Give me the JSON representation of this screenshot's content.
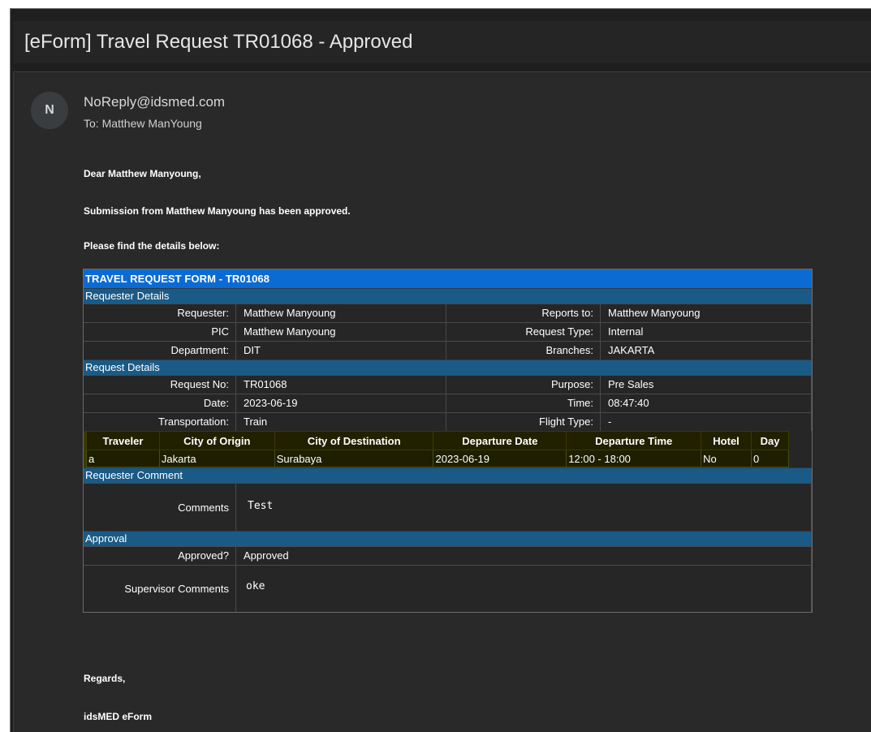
{
  "subject": "[eForm] Travel Request TR01068 - Approved",
  "sender": {
    "initial": "N",
    "from": "NoReply@idsmed.com",
    "to": "To:  Matthew ManYoung"
  },
  "body": {
    "greeting": "Dear Matthew Manyoung,",
    "line1": "Submission from Matthew Manyoung has been approved.",
    "line2": "Please find the details below:",
    "regards": "Regards,",
    "signature": "idsMED eForm"
  },
  "form": {
    "title": "TRAVEL REQUEST FORM - TR01068",
    "requester_section": "Requester Details",
    "requester_rows": [
      {
        "l1": "Requester:",
        "v1": "Matthew Manyoung",
        "l2": "Reports to:",
        "v2": "Matthew Manyoung"
      },
      {
        "l1": "PIC",
        "v1": "Matthew Manyoung",
        "l2": "Request Type:",
        "v2": "Internal"
      },
      {
        "l1": "Department:",
        "v1": "DIT",
        "l2": "Branches:",
        "v2": "JAKARTA"
      }
    ],
    "request_section": "Request Details",
    "request_rows": [
      {
        "l1": "Request No:",
        "v1": "TR01068",
        "l2": "Purpose:",
        "v2": "Pre Sales"
      },
      {
        "l1": "Date:",
        "v1": "2023-06-19",
        "l2": "Time:",
        "v2": "08:47:40"
      },
      {
        "l1": "Transportation:",
        "v1": "Train",
        "l2": "Flight Type:",
        "v2": "-"
      }
    ],
    "travel_headers": [
      "Traveler",
      "City of Origin",
      "City of Destination",
      "Departure Date",
      "Departure Time",
      "Hotel",
      "Day"
    ],
    "travel_row": [
      "a",
      "Jakarta",
      "Surabaya",
      "2023-06-19",
      "12:00 - 18:00",
      "No",
      "0"
    ],
    "comment_section": "Requester Comment",
    "comments_label": "Comments",
    "comments_value": "Test",
    "approval_section": "Approval",
    "approved_label": "Approved?",
    "approved_value": "Approved",
    "supervisor_label": "Supervisor Comments",
    "supervisor_value": "oke"
  }
}
